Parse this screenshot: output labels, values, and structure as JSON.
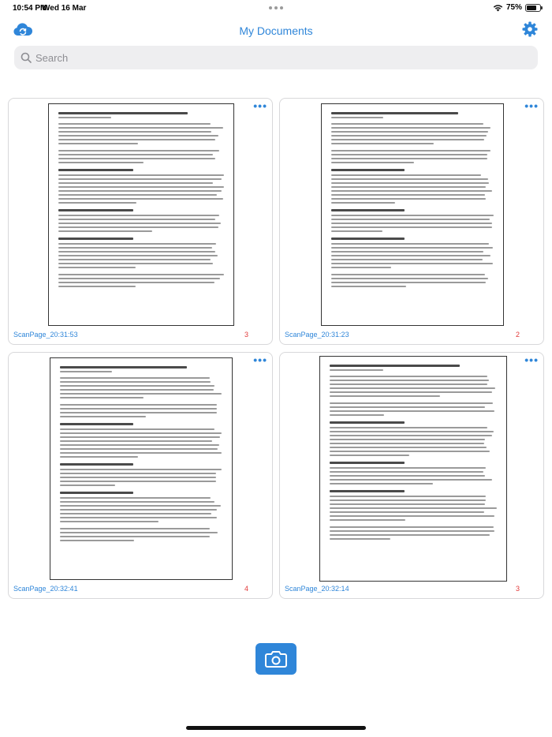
{
  "status": {
    "time": "10:54 PM",
    "date": "Wed 16 Mar",
    "battery": "75%",
    "battery_level": 0.75
  },
  "nav": {
    "title": "My Documents",
    "left_icon": "cloud-sync-icon",
    "right_icon": "gear-icon"
  },
  "search": {
    "placeholder": "Search",
    "value": ""
  },
  "documents": [
    {
      "name": "ScanPage_20:31:53",
      "pages": "3"
    },
    {
      "name": "ScanPage_20:31:23",
      "pages": "2"
    },
    {
      "name": "ScanPage_20:32:41",
      "pages": "4"
    },
    {
      "name": "ScanPage_20:32:14",
      "pages": "3"
    }
  ],
  "more_label": "•••",
  "camera": {
    "icon": "camera-icon"
  },
  "colors": {
    "accent": "#2f86d9",
    "count": "#e23b3b",
    "search_bg": "#eeeef0"
  }
}
